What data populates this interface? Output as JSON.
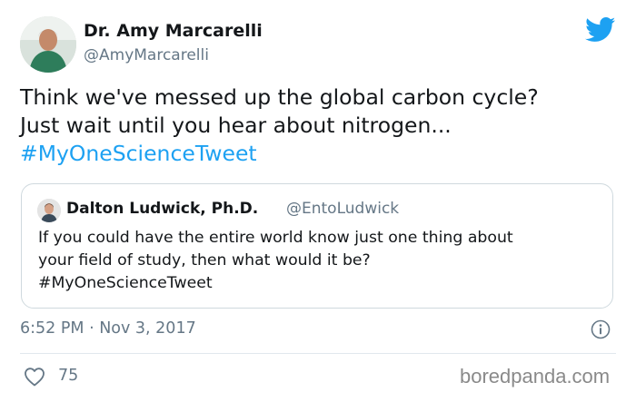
{
  "author": {
    "name": "Dr. Amy Marcarelli",
    "handle": "@AmyMarcarelli"
  },
  "tweet": {
    "line1": "Think we've messed up the global carbon cycle?",
    "line2": "Just wait until you hear about nitrogen...",
    "hashtag": "#MyOneScienceTweet"
  },
  "quote": {
    "name": "Dalton Ludwick, Ph.D.",
    "handle": "@EntoLudwick",
    "line1": "If you could have the entire world know just one thing about",
    "line2": "your field of study, then what would it be?",
    "hashtag": "#MyOneScienceTweet"
  },
  "meta": {
    "timestamp": "6:52 PM · Nov 3, 2017",
    "likes": "75"
  },
  "watermark": "boredpanda.com",
  "icons": {
    "brand": "twitter-bird-icon",
    "info": "info-icon",
    "like": "heart-icon"
  },
  "colors": {
    "link": "#1da1f2",
    "secondary_text": "#657786",
    "primary_text": "#14171a",
    "border": "#cfd9de"
  }
}
